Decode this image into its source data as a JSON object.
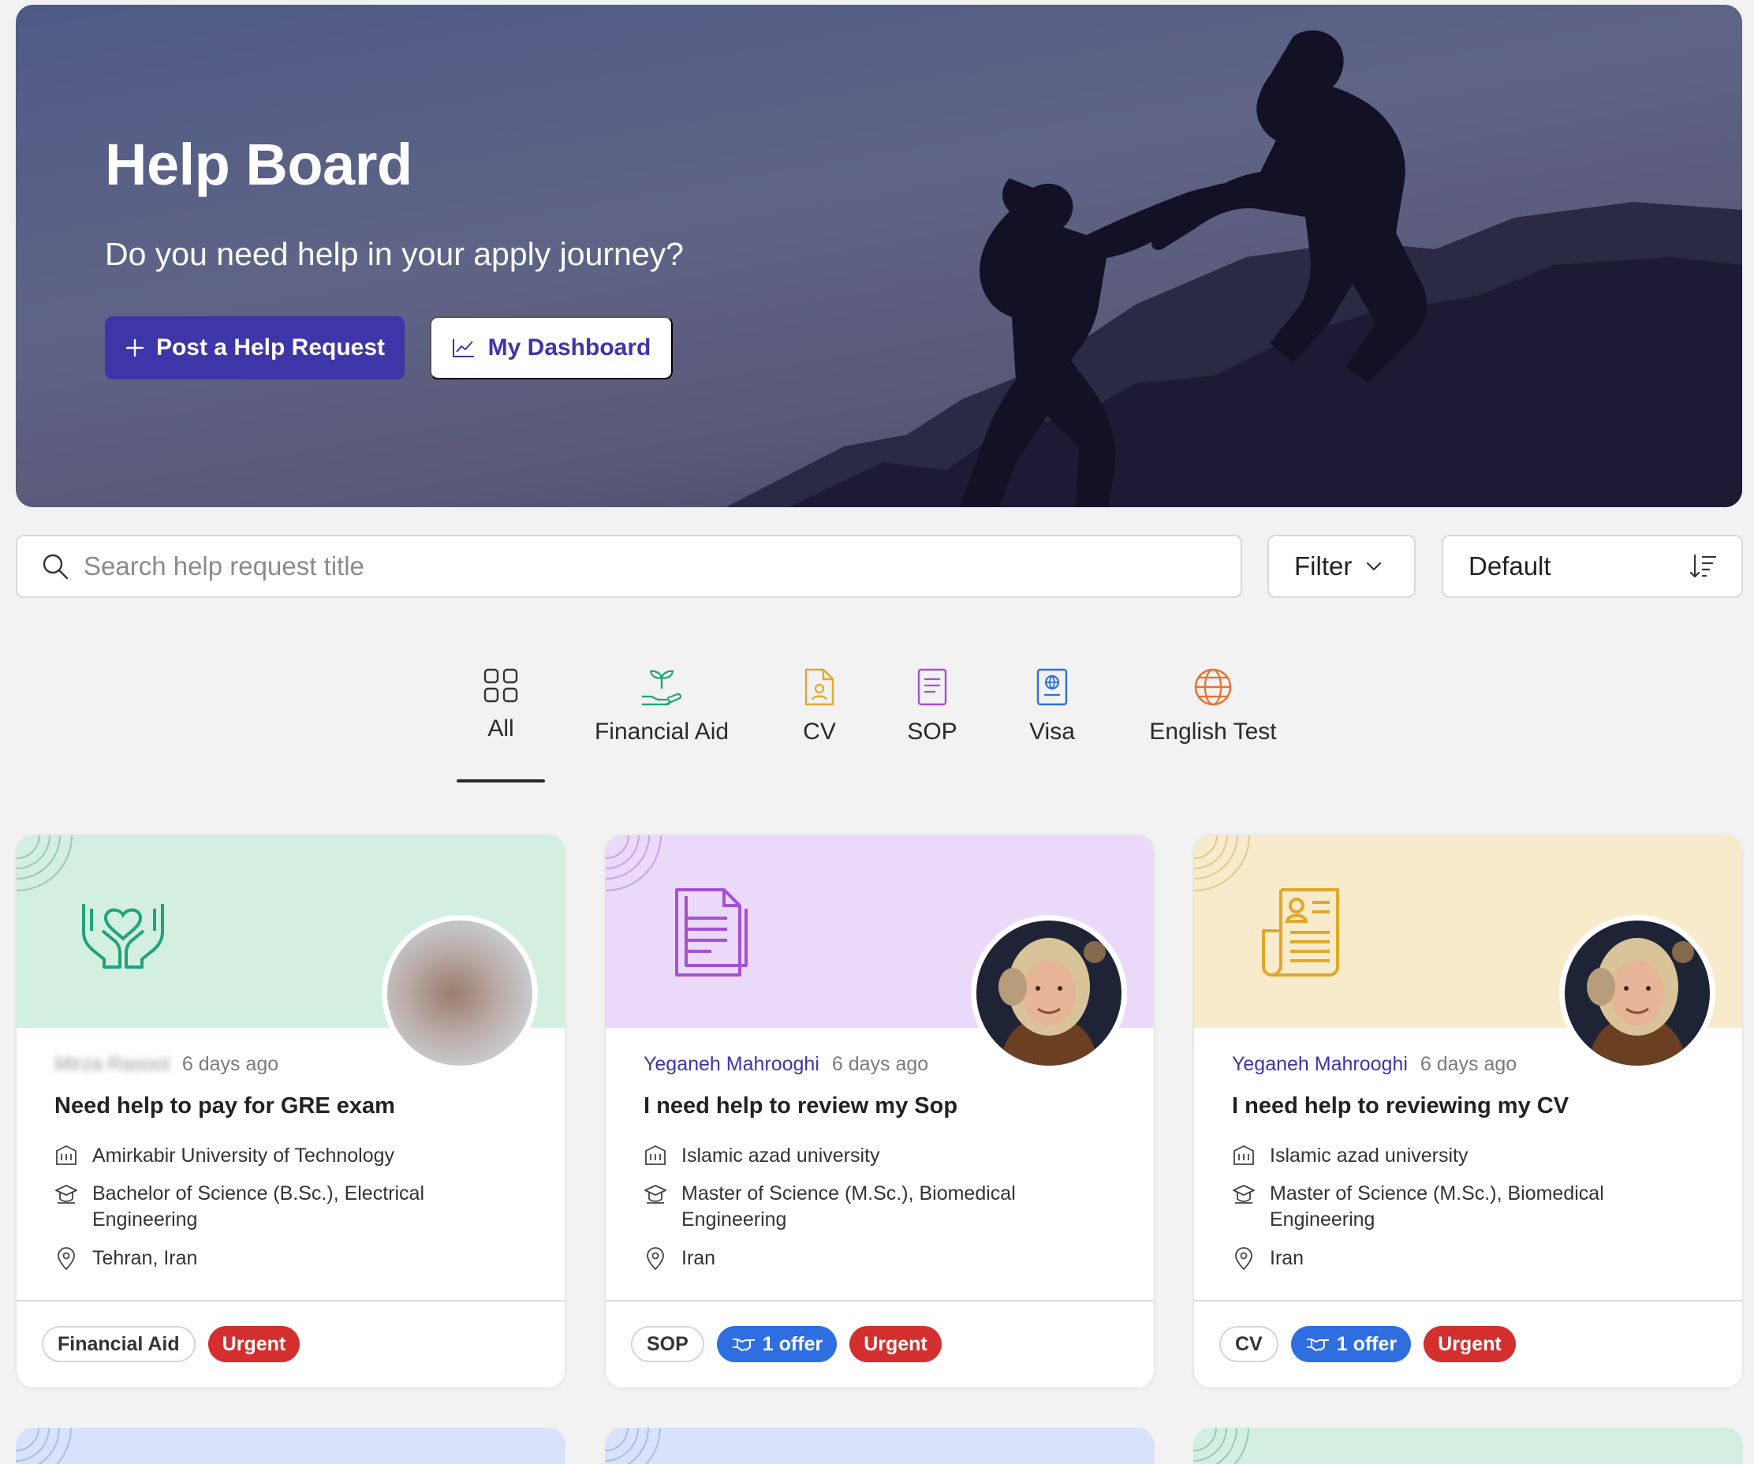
{
  "hero": {
    "title": "Help Board",
    "subtitle": "Do you need help in your apply journey?",
    "post_button": "Post a Help Request",
    "dashboard_button": "My Dashboard"
  },
  "toolbar": {
    "search_placeholder": "Search help request title",
    "filter_label": "Filter",
    "sort_label": "Default"
  },
  "tabs": [
    {
      "label": "All",
      "icon": "grid-icon",
      "active": true
    },
    {
      "label": "Financial Aid",
      "icon": "plant-hand-icon",
      "color": "#1fa37a"
    },
    {
      "label": "CV",
      "icon": "cv-file-icon",
      "color": "#e0a72a"
    },
    {
      "label": "SOP",
      "icon": "document-icon",
      "color": "#a450d8"
    },
    {
      "label": "Visa",
      "icon": "passport-icon",
      "color": "#2f6ee0"
    },
    {
      "label": "English Test",
      "icon": "globe-icon",
      "color": "#e8702a"
    }
  ],
  "cards": [
    {
      "banner_color": "#d2efe2",
      "type_icon": "heart-hands-icon",
      "author": "Mirza Rasool",
      "author_blurred": true,
      "time": "6 days ago",
      "title": "Need help to pay for GRE exam",
      "university": "Amirkabir University of Technology",
      "degree_line1": "Bachelor of Science (B.Sc.), Electrical",
      "degree_line2": "Engineering",
      "location": "Tehran, Iran",
      "category_tag": "Financial Aid",
      "urgent_tag": "Urgent"
    },
    {
      "banner_color": "#ead9f8",
      "type_icon": "document-icon",
      "author": "Yeganeh Mahrooghi",
      "time": "6 days ago",
      "title": "I need help to review my Sop",
      "university": "Islamic azad university",
      "degree_line1": "Master of Science (M.Sc.), Biomedical",
      "degree_line2": "Engineering",
      "location": "Iran",
      "category_tag": "SOP",
      "offer_tag": "1 offer",
      "urgent_tag": "Urgent"
    },
    {
      "banner_color": "#f8ebcc",
      "type_icon": "resume-icon",
      "author": "Yeganeh Mahrooghi",
      "time": "6 days ago",
      "title": "I need help to reviewing my CV",
      "university": "Islamic azad university",
      "degree_line1": "Master of Science (M.Sc.), Biomedical",
      "degree_line2": "Engineering",
      "location": "Iran",
      "category_tag": "CV",
      "offer_tag": "1 offer",
      "urgent_tag": "Urgent"
    }
  ],
  "colors": {
    "primary": "#3d35a8",
    "offer": "#2f6ee0",
    "urgent": "#d32f2f"
  }
}
